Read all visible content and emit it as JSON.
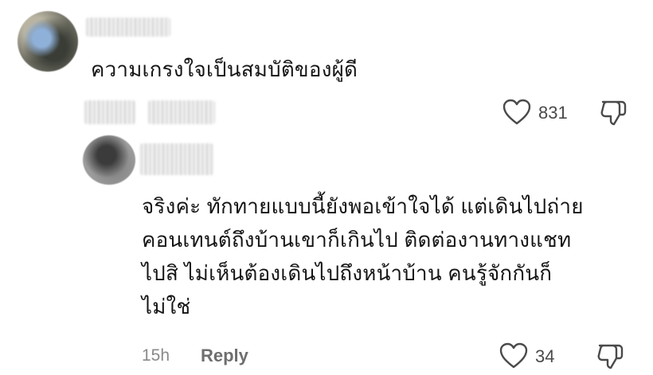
{
  "comment": {
    "text": "ความเกรงใจเป็นสมบัติของผู้ดี",
    "like_count": "831",
    "like_icon": "heart-icon",
    "dislike_icon": "thumb-down-icon"
  },
  "reply": {
    "text_lines": [
      "จริงค่ะ ทักทายแบบนี้ยังพอเข้าใจได้ แต่เดินไปถ่าย",
      "คอนเทนต์ถึงบ้านเขาก็เกินไป ติดต่องานทางแชท",
      "ไปสิ ไม่เห็นต้องเดินไปถึงหน้าบ้าน คนรู้จักกันก็",
      "ไม่ใช่"
    ],
    "time": "15h",
    "reply_label": "Reply",
    "like_count": "34",
    "like_icon": "heart-icon",
    "dislike_icon": "thumb-down-icon"
  }
}
